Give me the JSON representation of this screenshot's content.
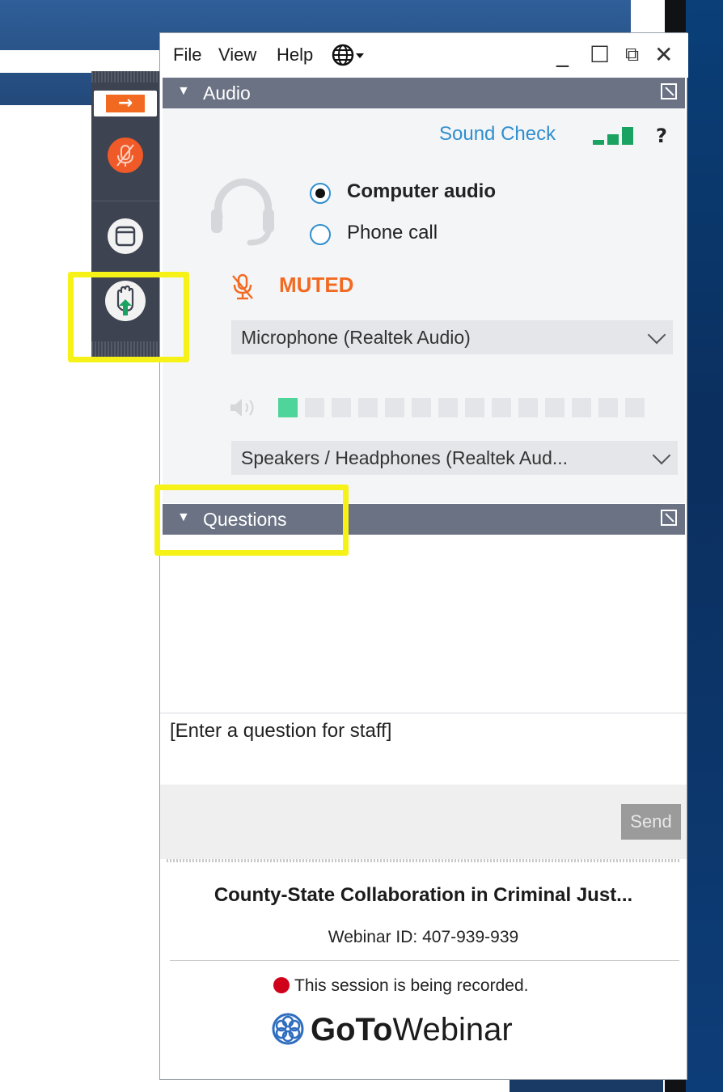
{
  "menu": {
    "file": "File",
    "view": "View",
    "help": "Help"
  },
  "window_controls": {
    "minimize": "_",
    "maximize": "☐",
    "restore": "⧉",
    "close": "✕"
  },
  "audio_panel": {
    "title": "Audio",
    "sound_check": "Sound Check",
    "help": "?",
    "options": [
      {
        "label": "Computer audio",
        "selected": true
      },
      {
        "label": "Phone call",
        "selected": false
      }
    ],
    "mute_status": "MUTED",
    "microphone": "Microphone (Realtek Audio)",
    "speakers": "Speakers / Headphones (Realtek Aud...",
    "speaker_level": 0.07,
    "colors": {
      "accent": "#f26a21",
      "link": "#2f8fce",
      "level": "#1aa260"
    }
  },
  "questions_panel": {
    "title": "Questions",
    "input_placeholder": "[Enter a question for staff]",
    "send": "Send"
  },
  "footer": {
    "title": "County-State Collaboration in Criminal Just...",
    "webinar_id": "Webinar ID: 407-939-939",
    "recording": "This session is being recorded.",
    "brand_bold": "GoTo",
    "brand_rest": "Webinar"
  },
  "control_panel": {
    "icons": [
      "arrow-right-icon",
      "microphone-muted-icon",
      "screen-icon",
      "raise-hand-icon"
    ]
  }
}
